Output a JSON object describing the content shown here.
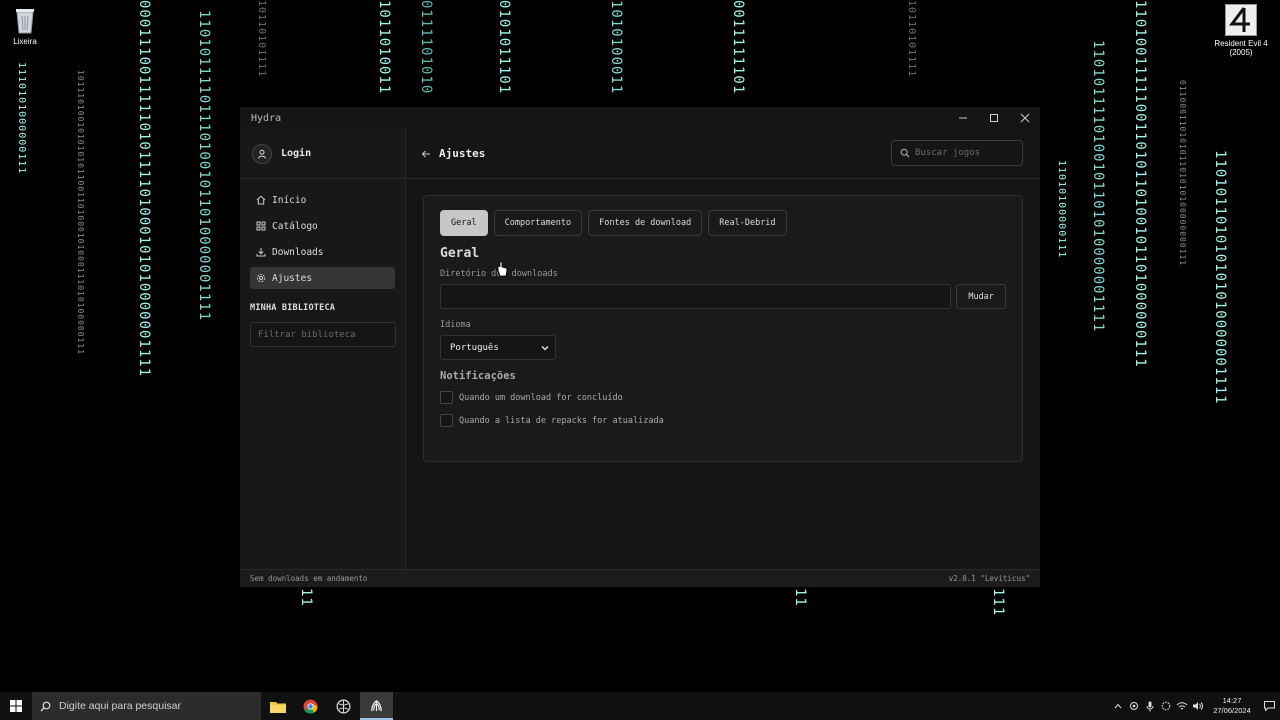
{
  "desktop": {
    "recycle_bin_label": "Lixeira",
    "game_shortcut_label": "Resident Evil 4 (2005)",
    "rain_colors": {
      "bright": "#9ff5ea",
      "mid": "#5fb8b0",
      "dim": "#6f6f6f"
    }
  },
  "window": {
    "title": "Hydra",
    "minimize_icon": "minimize-icon",
    "maximize_icon": "maximize-icon",
    "close_icon": "close-icon"
  },
  "sidebar": {
    "login_label": "Login",
    "items": [
      {
        "label": "Início",
        "icon": "home-icon",
        "active": false
      },
      {
        "label": "Catálogo",
        "icon": "grid-icon",
        "active": false
      },
      {
        "label": "Downloads",
        "icon": "download-icon",
        "active": false
      },
      {
        "label": "Ajustes",
        "icon": "gear-icon",
        "active": true
      }
    ],
    "library_title": "MINHA BIBLIOTECA",
    "library_filter_placeholder": "Filtrar biblioteca"
  },
  "header": {
    "title": "Ajustes",
    "search_placeholder": "Buscar jogos"
  },
  "settings": {
    "tabs": [
      {
        "label": "Geral",
        "active": true
      },
      {
        "label": "Comportamento",
        "active": false
      },
      {
        "label": "Fontes de download",
        "active": false
      },
      {
        "label": "Real-Debrid",
        "active": false
      }
    ],
    "section_title": "Geral",
    "downloads_dir_label": "Diretório dos downloads",
    "downloads_dir_value": "",
    "change_button": "Mudar",
    "language_label": "Idioma",
    "language_value": "Português",
    "notifications_title": "Notificações",
    "notifications": [
      {
        "label": "Quando um download for concluído",
        "checked": false
      },
      {
        "label": "Quando a lista de repacks for atualizada",
        "checked": false
      }
    ]
  },
  "statusbar": {
    "left": "Sem downloads em andamento",
    "right": "v2.0.1 \"Leviticus\""
  },
  "taskbar": {
    "search_placeholder": "Digite aqui para pesquisar",
    "time": "14:27",
    "date": "27/06/2024"
  }
}
